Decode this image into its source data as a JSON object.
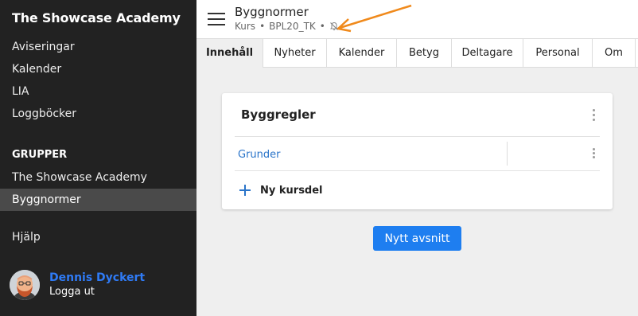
{
  "sidebar": {
    "app_title": "The Showcase Academy",
    "nav_items": [
      {
        "label": "Aviseringar"
      },
      {
        "label": "Kalender"
      },
      {
        "label": "LIA"
      },
      {
        "label": "Loggböcker"
      }
    ],
    "groups_heading": "GRUPPER",
    "group_items": [
      {
        "label": "The Showcase Academy",
        "active": false
      },
      {
        "label": "Byggnormer",
        "active": true
      }
    ],
    "help": "Hjälp",
    "user": {
      "name": "Dennis Dyckert",
      "logout": "Logga ut"
    }
  },
  "header": {
    "course_title": "Byggnormer",
    "meta_type": "Kurs",
    "meta_code": "BPL20_TK",
    "separator": "•",
    "mute_icon": "bell-off-icon"
  },
  "tabs": [
    {
      "label": "Innehåll",
      "active": true
    },
    {
      "label": "Nyheter",
      "active": false
    },
    {
      "label": "Kalender",
      "active": false
    },
    {
      "label": "Betyg",
      "active": false
    },
    {
      "label": "Deltagare",
      "active": false
    },
    {
      "label": "Personal",
      "active": false
    },
    {
      "label": "Om",
      "active": false
    }
  ],
  "card": {
    "title": "Byggregler",
    "parts": [
      {
        "label": "Grunder"
      }
    ],
    "add_part_label": "Ny kursdel"
  },
  "new_section_button": "Nytt avsnitt",
  "colors": {
    "sidebar_bg": "#222222",
    "active_nav_bg": "#4a4a4a",
    "accent": "#1e7ef0",
    "link": "#2a74c9",
    "annotation_arrow": "#f08a1c"
  }
}
